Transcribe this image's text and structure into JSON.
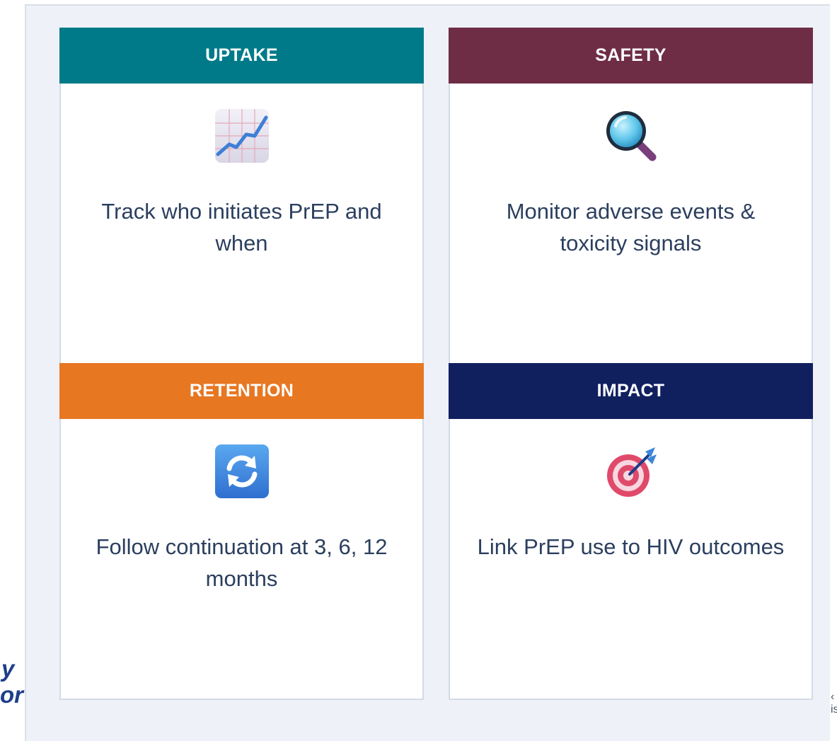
{
  "colors": {
    "uptake": "#007a89",
    "safety": "#6e2d45",
    "retention": "#e87722",
    "impact": "#10205f"
  },
  "cards": [
    {
      "title": "UPTAKE",
      "icon": "chart-increasing-icon",
      "text": "Track who initiates PrEP and when"
    },
    {
      "title": "SAFETY",
      "icon": "magnifying-glass-icon",
      "text": "Monitor adverse events & toxicity signals"
    },
    {
      "title": "RETENTION",
      "icon": "refresh-arrows-icon",
      "text": "Follow continuation at 3, 6, 12 months"
    },
    {
      "title": "IMPACT",
      "icon": "target-dart-icon",
      "text": "Link PrEP use to HIV outcomes"
    }
  ],
  "side_text": {
    "line1": "y",
    "line2": "or"
  },
  "logo_fragment": {
    "line1": "‹",
    "line2": "is"
  }
}
